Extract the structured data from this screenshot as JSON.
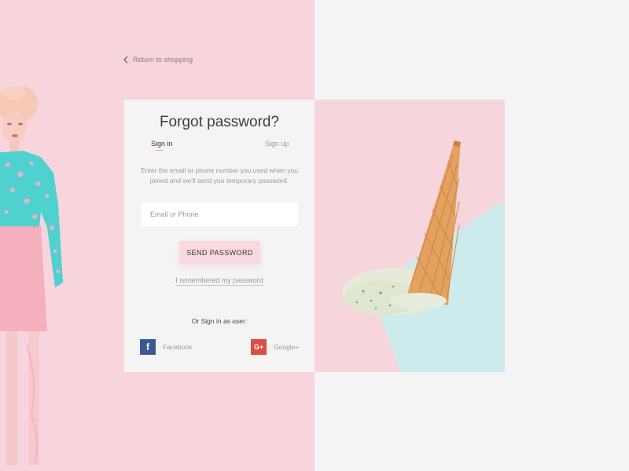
{
  "nav": {
    "back_label": "Return to shopping"
  },
  "card": {
    "title": "Forgot password?",
    "tabs": {
      "signin": "Sign in",
      "signup": "Sign up"
    },
    "description": "Enter the email or phone number you used when you joined and we'll send you temporary password.",
    "email_placeholder": "Email or Phone",
    "send_label": "SEND PASSWORD",
    "remember_label": "I remembered my password",
    "or_sign_label": "Or Sign in as user:",
    "social": {
      "facebook": "Facebook",
      "google": "Google+"
    }
  },
  "colors": {
    "left_bg": "#f8d5dc",
    "right_bg": "#f5f4f4",
    "button": "#f8d9df",
    "facebook": "#3b5998",
    "google": "#dc4e41",
    "photo_teal": "#cdebec"
  },
  "icons": {
    "back": "chevron-left-icon",
    "facebook": "facebook-icon",
    "google": "google-plus-icon"
  }
}
